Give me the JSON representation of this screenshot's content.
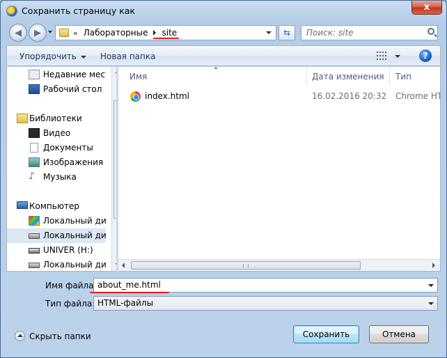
{
  "window": {
    "title": "Сохранить страницу как",
    "close_label": "x"
  },
  "address": {
    "overflow_label": "«",
    "path": [
      "Лабораторные",
      "site"
    ]
  },
  "search": {
    "placeholder": "Поиск: site"
  },
  "toolbar": {
    "organize_label": "Упорядочить",
    "new_folder_label": "Новая папка"
  },
  "nav": {
    "items": [
      {
        "label": "Недавние места",
        "icon": "recent-places-icon"
      },
      {
        "label": "Рабочий стол",
        "icon": "desktop-icon"
      },
      {
        "label": "Библиотеки",
        "icon": "libraries-icon"
      },
      {
        "label": "Видео",
        "icon": "video-icon"
      },
      {
        "label": "Документы",
        "icon": "documents-icon"
      },
      {
        "label": "Изображения",
        "icon": "pictures-icon"
      },
      {
        "label": "Музыка",
        "icon": "music-icon"
      },
      {
        "label": "Компьютер",
        "icon": "computer-icon"
      },
      {
        "label": "Локальный диск",
        "icon": "system-drive-icon"
      },
      {
        "label": "Локальный диск",
        "icon": "local-disk-icon"
      },
      {
        "label": "UNIVER (H:)",
        "icon": "removable-drive-icon"
      },
      {
        "label": "Локальный диск",
        "icon": "local-disk-icon"
      }
    ]
  },
  "files": {
    "columns": {
      "name": "Имя",
      "date": "Дата изменения",
      "type": "Тип"
    },
    "rows": [
      {
        "name": "index.html",
        "date": "16.02.2016 20:32",
        "type": "Chrome HTM",
        "icon": "chrome-html-icon"
      }
    ]
  },
  "form": {
    "filename_label": "Имя файла:",
    "filename_value": "about_me.html",
    "filetype_label": "Тип файла:",
    "filetype_value": "HTML-файлы"
  },
  "footer": {
    "hide_folders_label": "Скрыть папки",
    "save_label": "Сохранить",
    "cancel_label": "Отмена"
  },
  "colors": {
    "annotation_red": "#e01c1c",
    "accent": "#3c7fb1"
  }
}
